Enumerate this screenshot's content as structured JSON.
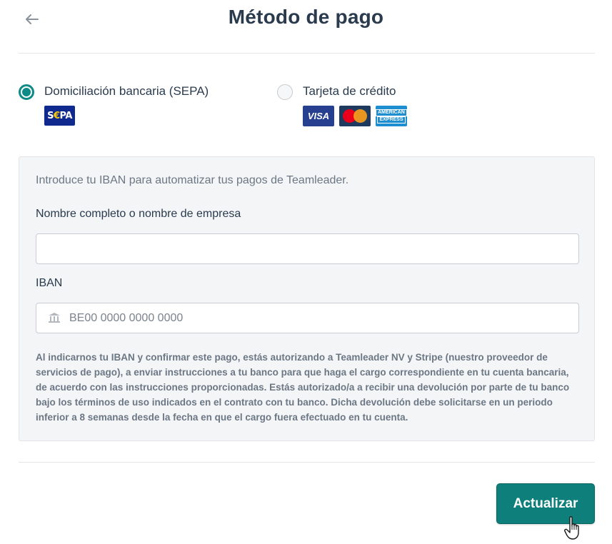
{
  "header": {
    "title": "Método de pago",
    "back_icon": "arrow-left-icon"
  },
  "payment_methods": {
    "selected": "sepa",
    "sepa": {
      "label": "Domiciliación bancaria (SEPA)",
      "logo": {
        "prefix": "S",
        "euro": "€",
        "suffix": "PA"
      }
    },
    "card": {
      "label": "Tarjeta de crédito",
      "logos": {
        "visa": "VISA",
        "mastercard": "mastercard-logo",
        "amex_line1": "AMERICAN",
        "amex_line2": "EXPRESS"
      }
    }
  },
  "form": {
    "intro": "Introduce tu IBAN para automatizar tus pagos de Teamleader.",
    "name_label": "Nombre completo o nombre de empresa",
    "name_value": "",
    "iban_label": "IBAN",
    "iban_placeholder": "BE00 0000 0000 0000",
    "iban_icon": "bank-icon",
    "legal": "Al indicarnos tu IBAN y confirmar este pago, estás autorizando a Teamleader NV y Stripe (nuestro proveedor de servicios de pago), a enviar instrucciones a tu banco para que haga el cargo correspondiente en tu cuenta bancaria, de acuerdo con las instrucciones proporcionadas. Estás autorizado/a a recibir una devolución por parte de tu banco bajo los términos de uso indicados en el contrato con tu banco. Dicha devolución debe solicitarse en un periodo inferior a 8 semanas desde la fecha en que el cargo fuera efectuado en tu cuenta."
  },
  "actions": {
    "update_label": "Actualizar"
  },
  "colors": {
    "accent": "#0e7f7b",
    "title": "#2a3b4d",
    "muted": "#6c7784"
  }
}
